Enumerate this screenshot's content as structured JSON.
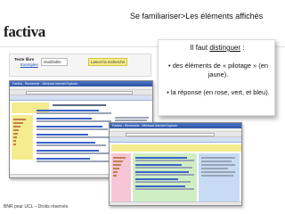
{
  "logo": {
    "wordmark": "factiva",
    "tagline": ""
  },
  "slide": {
    "title": "Se familiariser>Les éléments affichés"
  },
  "toolbar": {
    "free_text_label": "Texte libre",
    "examples_link": "Exemples",
    "field_value": "Modifiable",
    "search_button": "Lancer la recherche"
  },
  "callout": {
    "heading_prefix": "Il faut ",
    "heading_keyword": "distinguer",
    "heading_suffix": " :",
    "bullet_1": "• des éléments de « pilotage » (en jaune).",
    "bullet_2": "• la réponse (en rose, vert, et bleu)."
  },
  "screenshots": {
    "left_window_title": "Factiva - Recherche - Windows Internet Explorer",
    "right_window_title": "Factiva - Recherche - Windows Internet Explorer"
  },
  "footer": {
    "text": "BNR pour UCL – Droits réservés"
  },
  "colors": {
    "pilotage": "#f4ec8f",
    "response_pink": "#f6c6d7",
    "response_green": "#cfeec3",
    "response_blue": "#c8dbf4"
  }
}
